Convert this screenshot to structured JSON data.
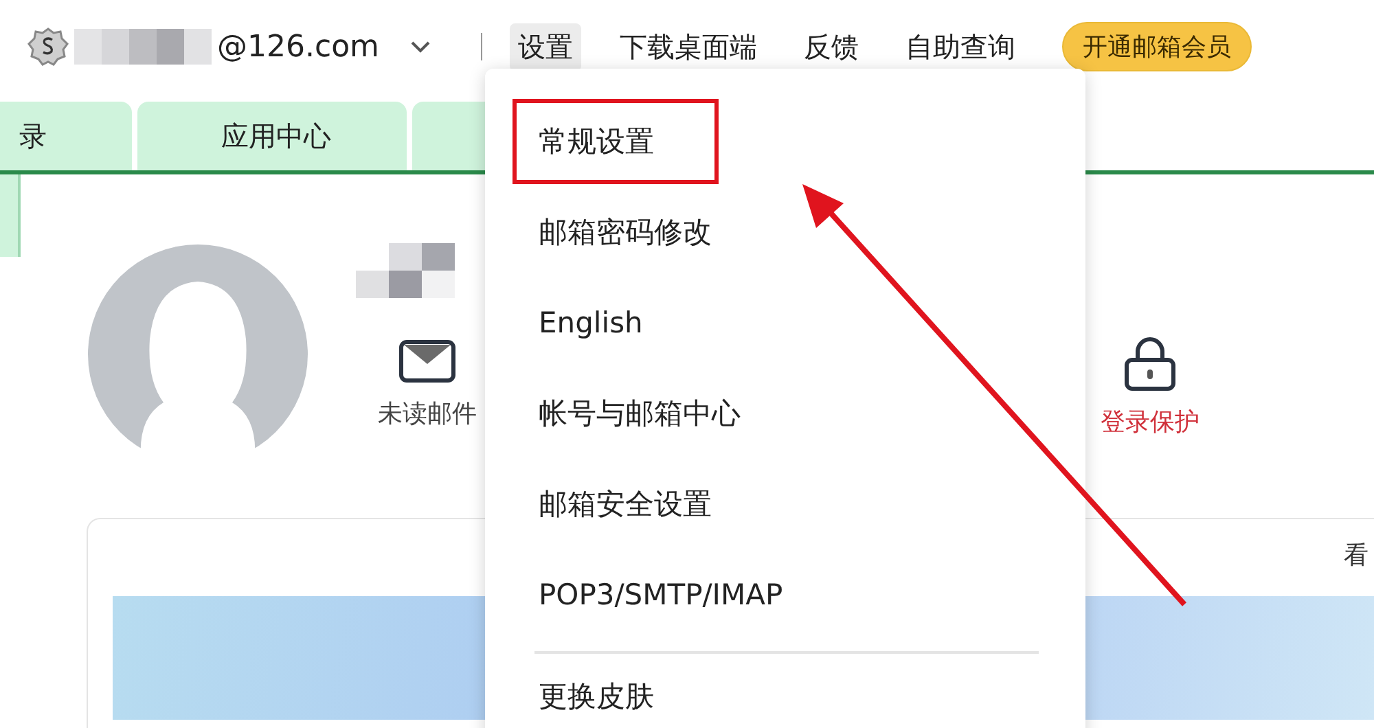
{
  "account": {
    "email": "@126.com"
  },
  "nav": [
    {
      "label": "设置",
      "selected": true
    },
    {
      "label": "下载桌面端",
      "selected": false
    },
    {
      "label": "反馈",
      "selected": false
    },
    {
      "label": "自助查询",
      "selected": false
    }
  ],
  "vip_button": "开通邮箱会员",
  "tabs": [
    {
      "kind": "label",
      "label": "录"
    },
    {
      "kind": "label",
      "label": "应用中心"
    },
    {
      "kind": "blank"
    }
  ],
  "profile": {
    "shortcuts": [
      {
        "kind": "mail",
        "label": "未读邮件"
      },
      {
        "kind": "lock",
        "label": "登录保护"
      }
    ]
  },
  "card": {
    "link": "看"
  },
  "settings_menu": {
    "items": [
      {
        "label": "常规设置",
        "highlighted": true
      },
      {
        "label": "邮箱密码修改",
        "highlighted": false
      },
      {
        "label": "English",
        "highlighted": false
      },
      {
        "label": "帐号与邮箱中心",
        "highlighted": false
      },
      {
        "label": "邮箱安全设置",
        "highlighted": false
      },
      {
        "label": "POP3/SMTP/IMAP",
        "highlighted": false
      }
    ],
    "footer_items": [
      {
        "label": "更换皮肤"
      }
    ]
  }
}
